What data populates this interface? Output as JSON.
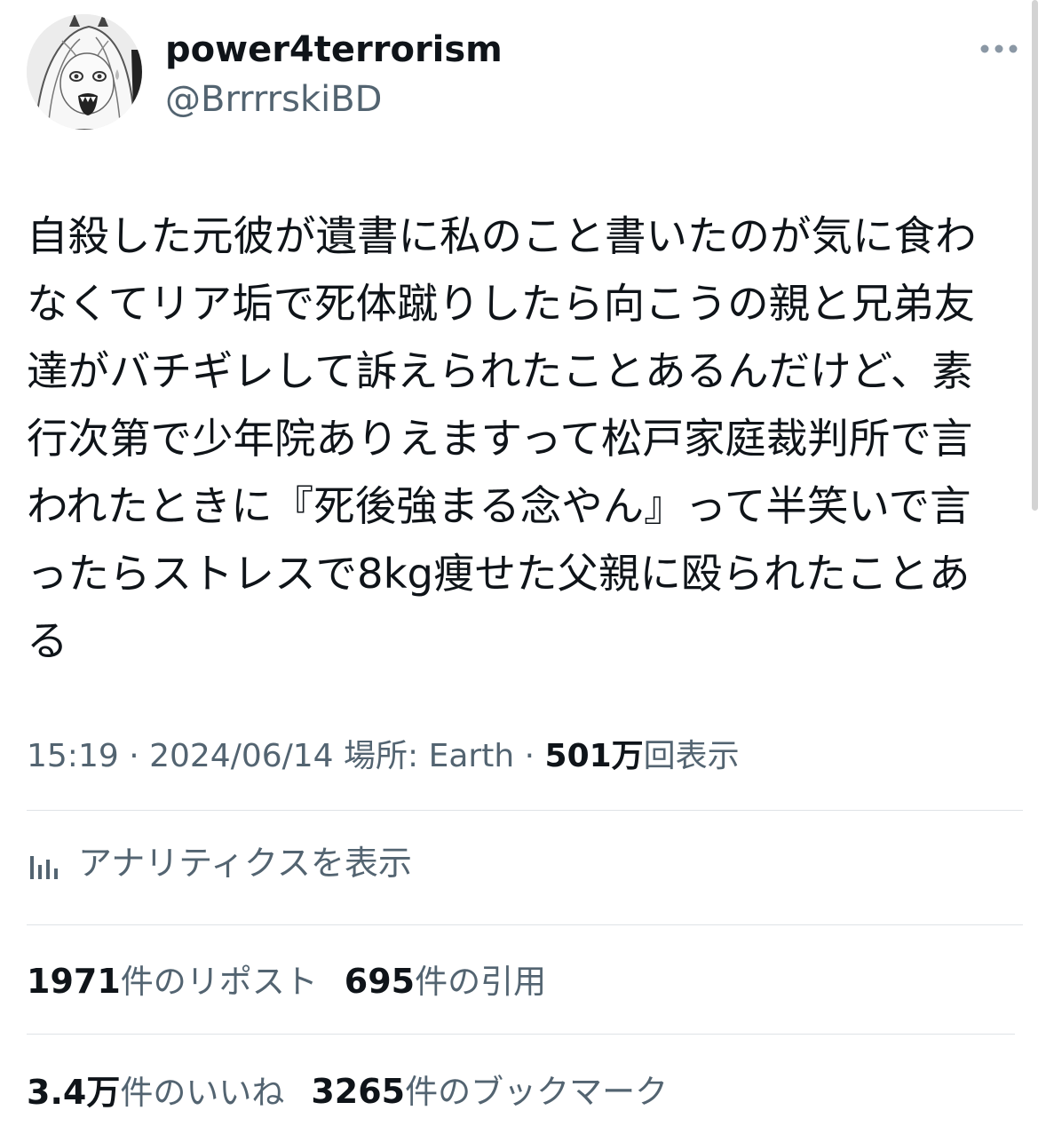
{
  "author": {
    "display_name": "power4terrorism",
    "handle": "@BrrrrskiBD",
    "avatar_icon": "manga-character-avatar"
  },
  "more_icon": "more-dots-icon",
  "tweet": {
    "text": "自殺した元彼が遺書に私のこと書いたのが気に食わなくてリア垢で死体蹴りしたら向こうの親と兄弟友達がバチギレして訴えられたことあるんだけど、素行次第で少年院ありえますって松戸家庭裁判所で言われたときに『死後強まる念やん』って半笑いで言ったらストレスで8kg痩せた父親に殴られたことある"
  },
  "meta": {
    "time": "15:19",
    "separator1": " · ",
    "date": "2024/06/14",
    "location": "場所: Earth",
    "separator2": " · ",
    "views_count": "501万",
    "views_label": "回表示"
  },
  "analytics": {
    "icon": "analytics-bar-icon",
    "label": "アナリティクスを表示"
  },
  "stats": {
    "reposts": {
      "count": "1971",
      "label": "件のリポスト"
    },
    "quotes": {
      "count": "695",
      "label": "件の引用"
    },
    "likes": {
      "count": "3.4万",
      "label": "件のいいね"
    },
    "bookmarks": {
      "count": "3265",
      "label": "件のブックマーク"
    }
  },
  "colors": {
    "text_primary": "#0f1419",
    "text_secondary": "#536471",
    "divider": "#dfe3e7",
    "background": "#ffffff"
  }
}
